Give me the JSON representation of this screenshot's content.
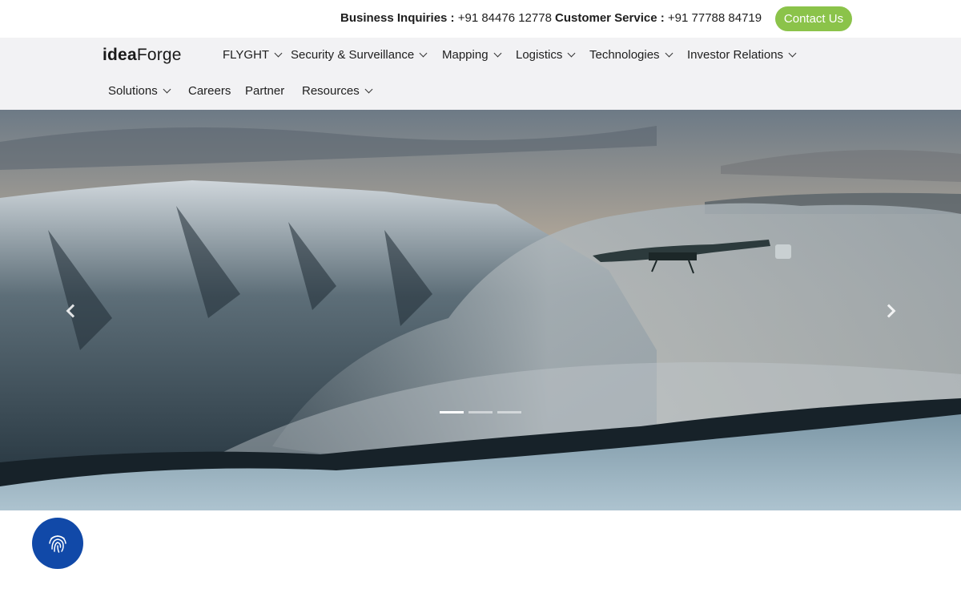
{
  "topbar": {
    "business_label": "Business Inquiries :",
    "business_phone": "+91 84476 12778",
    "customer_label": "Customer Service :",
    "customer_phone": "+91 77788 84719",
    "contact_button": "Contact Us"
  },
  "brand": {
    "logo_strong": "idea",
    "logo_rest": "Forge"
  },
  "nav": {
    "row1": [
      {
        "label": "FLYGHT",
        "dropdown": true
      },
      {
        "label": "Security & Surveillance",
        "dropdown": true
      },
      {
        "label": "Mapping",
        "dropdown": true
      },
      {
        "label": "Logistics",
        "dropdown": true
      },
      {
        "label": "Technologies",
        "dropdown": true
      },
      {
        "label": "Investor Relations",
        "dropdown": true
      }
    ],
    "row2": [
      {
        "label": "Solutions",
        "dropdown": true
      },
      {
        "label": "Careers",
        "dropdown": false
      },
      {
        "label": "Partner",
        "dropdown": false
      },
      {
        "label": "Resources",
        "dropdown": true
      }
    ]
  },
  "hero": {
    "slides": 3,
    "active_slide": 1,
    "icons": {
      "prev": "chevron-left-icon",
      "next": "chevron-right-icon"
    }
  },
  "floating": {
    "icon": "fingerprint-icon",
    "color": "#1149a8"
  },
  "colors": {
    "accent": "#8bc34a",
    "nav_bg": "#f2f2f4"
  }
}
